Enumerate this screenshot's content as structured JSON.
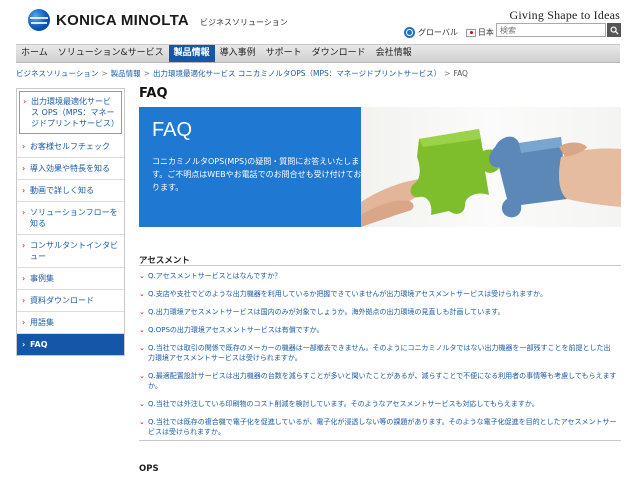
{
  "header": {
    "logo_text": "KONICA MINOLTA",
    "logo_sub": "ビジネスソリューション",
    "tagline": "Giving Shape to Ideas",
    "global_label": "グローバル",
    "japan_label": "日本",
    "search_placeholder": "検索"
  },
  "nav": {
    "items": [
      "ホーム",
      "ソリューション&サービス",
      "製品情報",
      "導入事例",
      "サポート",
      "ダウンロード",
      "会社情報"
    ],
    "active_index": 2
  },
  "breadcrumb": {
    "items": [
      "ビジネスソリューション",
      "製品情報",
      "出力環境最適化サービス コニカミノルタOPS（MPS：マネージドプリントサービス）"
    ],
    "current": "FAQ"
  },
  "sidebar": {
    "items": [
      "出力環境最適化サービス OPS（MPS：マネージドプリントサービス）",
      "お客様セルフチェック",
      "導入効果や特長を知る",
      "動画で詳しく知る",
      "ソリューションフローを知る",
      "コンサルタントインタビュー",
      "事例集",
      "資料ダウンロード",
      "用語集",
      "FAQ"
    ],
    "active_index": 9
  },
  "main": {
    "title": "FAQ",
    "hero": {
      "title": "FAQ",
      "text": "コニカミノルタOPS(MPS)の疑問・質問にお答えいたします。ご不明点はWEBやお電話でのお問合せも受け付けております。"
    },
    "section_assessment": "アセスメント",
    "faqs": [
      "Q.アセスメントサービスとはなんですか？",
      "Q.支店や支社でどのような出力機器を利用しているか把握できていませんが出力環境アセスメントサービスは受けられますか。",
      "Q.出力環境アセスメントサービスは国内のみが対象でしょうか。海外拠点の出力環境の見直しも計画しています。",
      "Q.OPSの出力環境アセスメントサービスは有償ですか。",
      "Q.当社では取引の関係で既存のメーカーの機器は一部撤去できません。そのようにコニカミノルタではない出力機器を一部残すことを前提とした出力環境アセスメントサービスは受けられますか。",
      "Q.最適配置設計サービスは出力機器の台数を減らすことが多いと聞いたことがあるが、減らすことで不便になる利用者の事情等も考慮してもらえますか。",
      "Q.当社では外注している印刷物のコスト削減を検討しています。そのようなアセスメントサービスも対応してもらえますか。",
      "Q.当社では既存の複合機で電子化を促進しているが、電子化が浸透しない等の課題があります。そのような電子化促進を目的としたアセスメントサービスは受けられますか。"
    ],
    "section_ops": "OPS"
  }
}
